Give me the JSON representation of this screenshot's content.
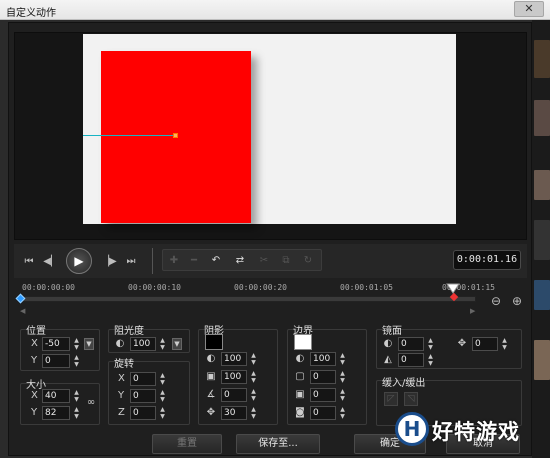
{
  "window": {
    "title": "自定义动作",
    "close_icon": "close-icon"
  },
  "preview": {
    "canvas_color": "#f2f2f2",
    "object_color": "#ff0000",
    "path_color": "#18b4c4"
  },
  "playback": {
    "timecode": "0:00:01.16",
    "buttons": [
      "go-to-start-icon",
      "previous-frame-icon",
      "play-icon",
      "next-frame-icon",
      "go-to-end-icon"
    ],
    "motion_tools": [
      "add-keyframe-icon",
      "remove-keyframe-icon",
      "reverse-path-icon",
      "swap-icon",
      "cut-icon",
      "copy-icon",
      "paste-icon"
    ]
  },
  "timeline": {
    "ticks": [
      "00:00:00:00",
      "00:00:00:10",
      "00:00:00:20",
      "00:00:01:05",
      "00:00:01:15"
    ]
  },
  "groups": {
    "position": {
      "label": "位置",
      "x_label": "X",
      "x_value": "-50",
      "y_label": "Y",
      "y_value": "0"
    },
    "size": {
      "label": "大小",
      "x_label": "X",
      "x_value": "40",
      "y_label": "Y",
      "y_value": "82"
    },
    "opacity": {
      "label": "阻光度",
      "value": "100"
    },
    "rotation": {
      "label": "旋转",
      "x_label": "X",
      "x_value": "0",
      "y_label": "Y",
      "y_value": "0",
      "z_label": "Z",
      "z_value": "0"
    },
    "shadow": {
      "label": "阴影",
      "color": "#000000",
      "v1": "100",
      "v2": "100",
      "v3": "0",
      "v4": "30"
    },
    "border": {
      "label": "边界",
      "color": "#ffffff",
      "v1": "100",
      "v2": "0",
      "v3": "0",
      "v4": "0"
    },
    "mirror": {
      "label": "镜面",
      "v1": "0",
      "v2": "0",
      "v3": "0",
      "v4": "0"
    },
    "fade": {
      "label": "缓入/缓出"
    }
  },
  "buttons": {
    "reset": "重置",
    "save_as": "保存至...",
    "ok": "确定",
    "cancel": "取消"
  },
  "watermark": {
    "text": "好特游戏",
    "icon_letter": "H"
  }
}
